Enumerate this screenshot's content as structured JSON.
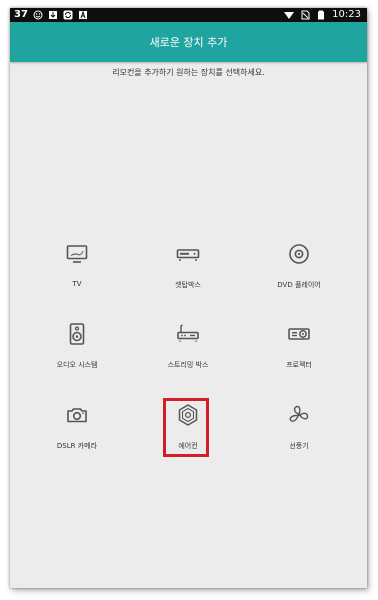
{
  "status_bar": {
    "notification_count": "37",
    "time": "10:23"
  },
  "header": {
    "title": "새로운 장치 추가"
  },
  "instruction": "리모컨을 추가하기 원하는 장치를 선택하세요.",
  "devices": [
    {
      "label": "TV",
      "icon": "tv-icon"
    },
    {
      "label": "셋탑박스",
      "icon": "set-top-box-icon"
    },
    {
      "label": "DVD 플레이어",
      "icon": "dvd-icon"
    },
    {
      "label": "오디오 시스템",
      "icon": "speaker-icon"
    },
    {
      "label": "스트리밍 박스",
      "icon": "router-icon"
    },
    {
      "label": "프로젝터",
      "icon": "projector-icon"
    },
    {
      "label": "DSLR 카메라",
      "icon": "camera-icon"
    },
    {
      "label": "에어컨",
      "icon": "air-conditioner-icon"
    },
    {
      "label": "선풍기",
      "icon": "fan-icon"
    }
  ],
  "highlighted_device": "에어컨",
  "colors": {
    "appbar": "#20a49f",
    "background": "#ececec",
    "highlight_border": "#d21f27",
    "icon": "#555555"
  }
}
